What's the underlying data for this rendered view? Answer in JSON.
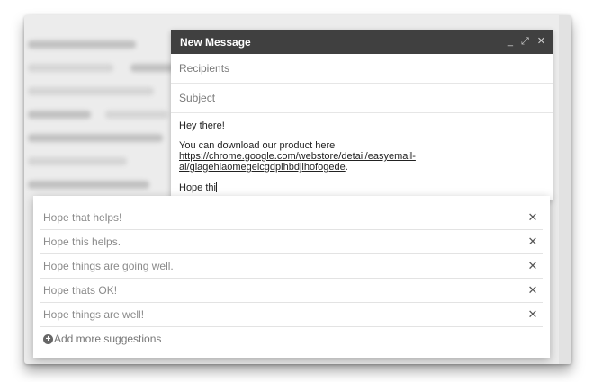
{
  "compose": {
    "title": "New Message",
    "minimize_icon": "minimize-icon",
    "expand_icon": "expand-icon",
    "close_icon": "close-icon",
    "minimize_glyph": "_",
    "expand_glyph": "⤢",
    "close_glyph": "✕",
    "recipients_placeholder": "Recipients",
    "subject_placeholder": "Subject",
    "body": {
      "greeting": "Hey there!",
      "line1": "You can download our product here",
      "link_part1": "https://chrome.google.com/webstore/detail/easyemail-",
      "link_part2": "ai/giagehiaomegelcgdpihbdjihofogede",
      "link_suffix": ".",
      "typed": "Hope thi"
    }
  },
  "suggestions": {
    "items": [
      {
        "text": "Hope that helps!",
        "remove": "✕"
      },
      {
        "text": "Hope this helps.",
        "remove": "✕"
      },
      {
        "text": "Hope things are going well.",
        "remove": "✕"
      },
      {
        "text": "Hope thats OK!",
        "remove": "✕"
      },
      {
        "text": "Hope things are well!",
        "remove": "✕"
      }
    ],
    "add_more_icon": "+",
    "add_more_label": "Add more suggestions"
  }
}
